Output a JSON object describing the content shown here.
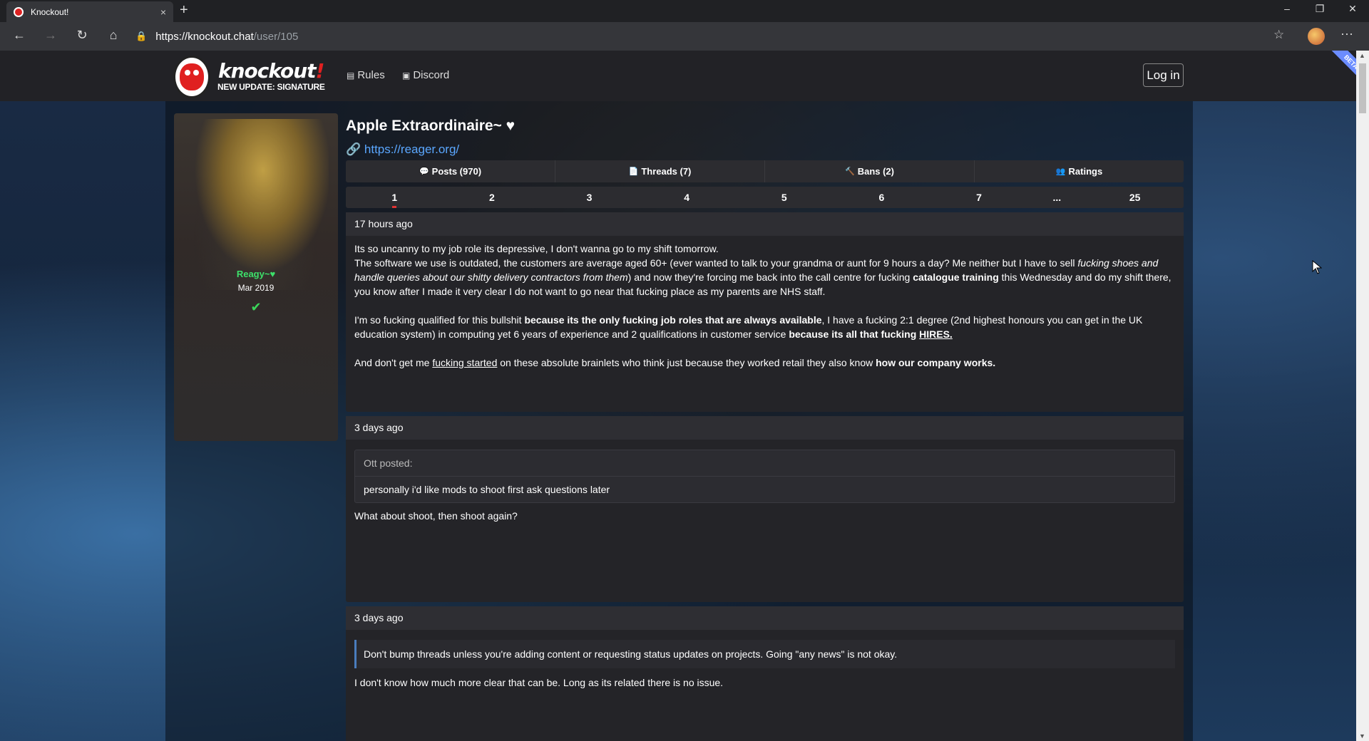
{
  "browser": {
    "tab_title": "Knockout!",
    "tab_close": "×",
    "new_tab": "+",
    "url_host": "https://knockout.chat",
    "url_path": "/user/105",
    "controls": {
      "minimize": "–",
      "restore": "❐",
      "close": "✕"
    },
    "nav": {
      "back": "←",
      "forward": "→",
      "reload": "↻",
      "home": "⌂"
    },
    "more": "···",
    "star": "☆",
    "lock": "🔒"
  },
  "site": {
    "logo_text": "knockout",
    "logo_bang": "!",
    "tagline": "NEW UPDATE: SIGNATURE",
    "nav": [
      {
        "label": "Rules",
        "icon": "book-icon"
      },
      {
        "label": "Discord",
        "icon": "chat-icon"
      }
    ],
    "login_label": "Log in",
    "beta_label": "BETA"
  },
  "profile": {
    "username": "Reagy~♥",
    "joined": "Mar 2019",
    "verified": "✔",
    "title": "Apple Extraordinaire~ ♥",
    "link": "https://reager.org/",
    "link_icon": "🔗"
  },
  "tabs": [
    {
      "label": "Posts (970)",
      "icon": "💬"
    },
    {
      "label": "Threads (7)",
      "icon": "📄"
    },
    {
      "label": "Bans (2)",
      "icon": "🔨"
    },
    {
      "label": "Ratings",
      "icon": "👥"
    }
  ],
  "pagination": [
    "1",
    "2",
    "3",
    "4",
    "5",
    "6",
    "7",
    "...",
    "25"
  ],
  "pagination_current": "1",
  "posts": [
    {
      "time": "17 hours ago",
      "p1_a": "Its so uncanny to my job role its depressive, I don't wanna go to my shift tomorrow.",
      "p1_b": "The software we use is outdated, the customers are average aged 60+ (ever wanted to talk to your grandma or aunt for 9 hours a day? Me neither but I have to sell ",
      "p1_c": "fucking shoes and handle queries about our shitty delivery contractors from them",
      "p1_d": ") and now they're forcing me back into the call centre for fucking ",
      "p1_e": "catalogue training",
      "p1_f": " this Wednesday and do my shift there, you know after I made it very clear I do not want to go near that fucking place as my parents are NHS staff.",
      "p2_a": "I'm so fucking qualified for this bullshit ",
      "p2_b": "because its the only fucking job roles that are always available",
      "p2_c": ", I have a fucking 2:1 degree (2nd highest honours you can get in the UK education system) in computing yet 6 years of experience and 2 qualifications in customer service ",
      "p2_d": "because its all that fucking ",
      "p2_e": "HIRES.",
      "p3_a": "And don't get me ",
      "p3_b": "fucking started",
      "p3_c": " on these absolute brainlets who think just because they worked retail they also know ",
      "p3_d": "how our company works."
    },
    {
      "time": "3 days ago",
      "quote_head": "Ott posted:",
      "quote_body": "personally i'd like mods to shoot first ask questions later",
      "text": "What about shoot, then shoot again?"
    },
    {
      "time": "3 days ago",
      "blockquote": "Don't bump threads unless you're adding content or requesting status updates on projects. Going \"any news\" is not okay.",
      "text": "I don't know how much more clear that can be. Long as its related there is no issue."
    }
  ]
}
